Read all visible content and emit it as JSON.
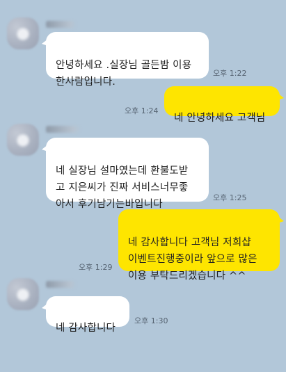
{
  "chat": {
    "background_color": "#b2c7d9",
    "incoming_bubble_color": "#ffffff",
    "outgoing_bubble_color": "#fee500",
    "messages": [
      {
        "direction": "incoming",
        "text": "안녕하세요 .실장님 골든밤 이용\n한사람입니다.",
        "time": "오후 1:22"
      },
      {
        "direction": "outgoing",
        "text": "네 안녕하세요 고객님",
        "time": "오후 1:24"
      },
      {
        "direction": "incoming",
        "text": "네 실장님 설마였는데 환불도받\n고 지은씨가 진짜 서비스너무좋\n아서 후기남기는바입니다",
        "time": "오후 1:25"
      },
      {
        "direction": "outgoing",
        "text": "네 감사합니다 고객님 저희샵\n이벤트진행중이라 앞으로 많은\n이용 부탁드리겠습니다 ^^",
        "time": "오후 1:29"
      },
      {
        "direction": "incoming",
        "text": "네 감사합니다",
        "time": "오후 1:30"
      }
    ]
  }
}
